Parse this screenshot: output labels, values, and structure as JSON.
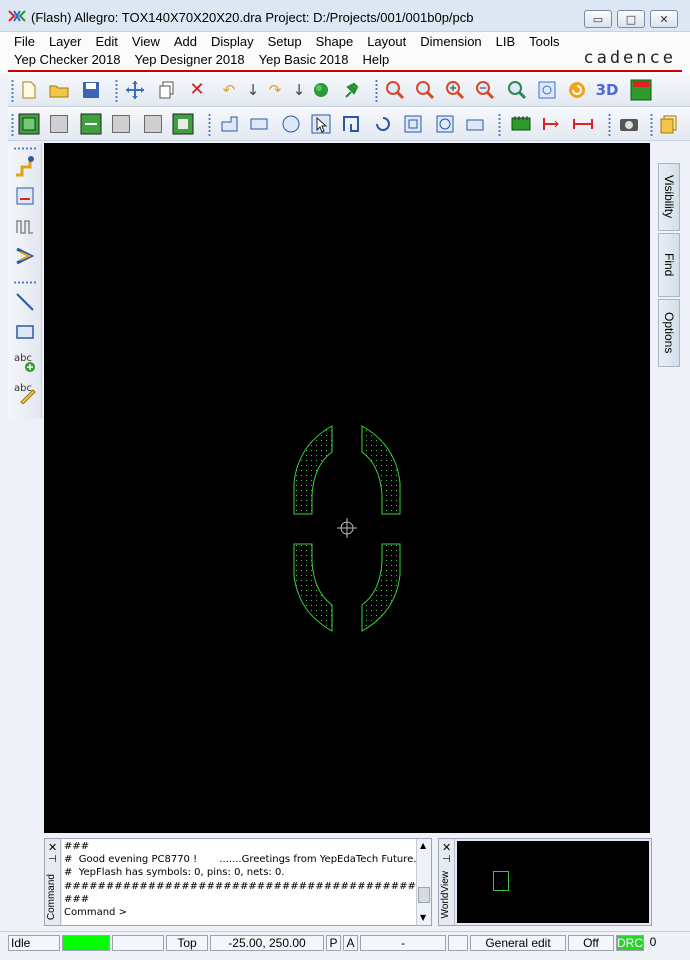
{
  "window": {
    "title": "(Flash) Allegro: TOX140X70X20X20.dra  Project: D:/Projects/001/001b0p/pcb",
    "min_glyph": "▭",
    "max_glyph": "□",
    "close_glyph": "✕"
  },
  "menu": {
    "row1": [
      "File",
      "Layer",
      "Edit",
      "View",
      "Add",
      "Display",
      "Setup",
      "Shape",
      "Layout",
      "Dimension",
      "LIB",
      "Tools"
    ],
    "row2": [
      "Yep Checker 2018",
      "Yep Designer 2018",
      "Yep Basic 2018",
      "Help"
    ],
    "brand": "cadence"
  },
  "right_tabs": [
    "Visibility",
    "Find",
    "Options"
  ],
  "command_window": {
    "label": "Command",
    "lines": [
      "###",
      "#  Good evening PC8770 !       .......Greetings from YepEdaTech Future.",
      "#  YepFlash has symbols: 0, pins: 0, nets: 0.",
      "####################################################################",
      "###",
      "Command >"
    ]
  },
  "worldview": {
    "label": "WorldView"
  },
  "status": {
    "state": "Idle",
    "indicator_color": "#00ff00",
    "layer": "Top",
    "coordinates": "-25.00, 250.00",
    "p_toggle": "P",
    "a_toggle": "A",
    "selection": "-",
    "mode": "General edit",
    "off_state": "Off",
    "drc_label": "DRC",
    "drc_count": "0",
    "drc_color": "#2ed02e"
  },
  "colors": {
    "canvas_bg": "#000000",
    "shape_outline": "#3cd23c",
    "accent_red": "#d00000"
  }
}
